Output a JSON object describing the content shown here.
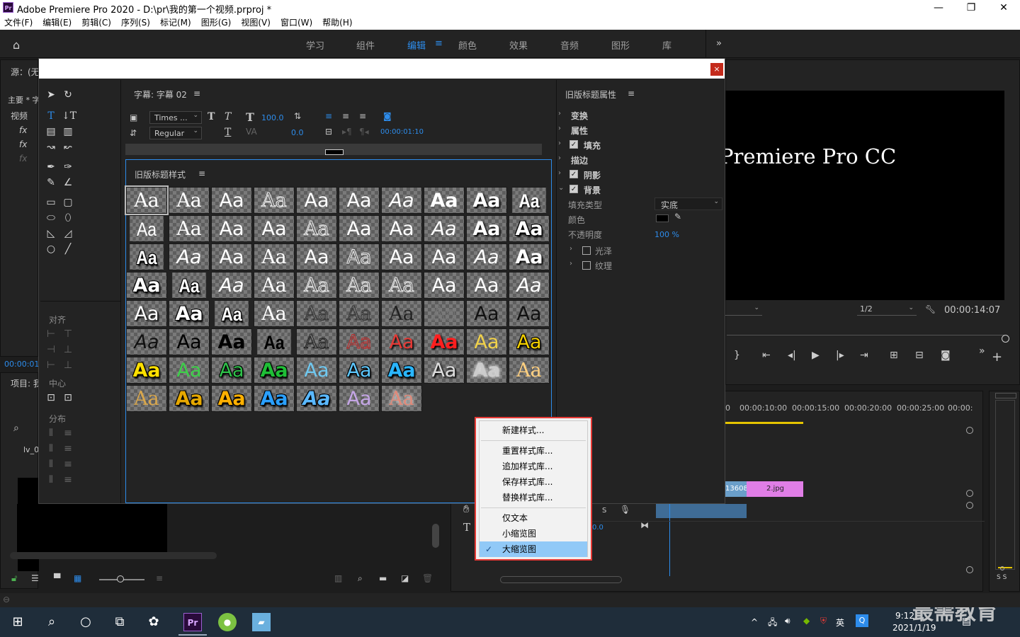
{
  "window": {
    "title": "Adobe Premiere Pro 2020 - D:\\pr\\我的第一个视频.prproj *",
    "logo": "Pr"
  },
  "menu": [
    "文件(F)",
    "编辑(E)",
    "剪辑(C)",
    "序列(S)",
    "标记(M)",
    "图形(G)",
    "视图(V)",
    "窗口(W)",
    "帮助(H)"
  ],
  "workspaces": [
    "学习",
    "组件",
    "编辑",
    "颜色",
    "效果",
    "音频",
    "图形",
    "库"
  ],
  "active_workspace": "编辑",
  "left": {
    "source_label": "源：(无",
    "main_label": "主要 * 字",
    "video_label": "视频",
    "time": "00:00:01:",
    "project_label": "项目: 我",
    "clip": "lv_0"
  },
  "titler": {
    "panel_title": "字幕: 字幕 02",
    "font_family": "Times ...",
    "font_style": "Regular",
    "font_size": "100.0",
    "kerning": "0.0",
    "timecode": "00:00:01:10",
    "styles_title": "旧版标题样式",
    "sections": {
      "align": "对齐",
      "center": "中心",
      "distribute": "分布"
    }
  },
  "properties": {
    "title": "旧版标题属性",
    "items": [
      "变换",
      "属性",
      "填充",
      "描边",
      "阴影",
      "背景"
    ],
    "fill_type_label": "填充类型",
    "fill_type_value": "实底",
    "color_label": "颜色",
    "opacity_label": "不透明度",
    "opacity_value": "100 %",
    "gloss": "光泽",
    "texture": "纹理"
  },
  "context_menu": {
    "items": [
      "新建样式...",
      "重置样式库...",
      "追加样式库...",
      "保存样式库...",
      "替换样式库...",
      "仅文本",
      "小缩览图",
      "大缩览图"
    ],
    "checked": "大缩览图"
  },
  "program": {
    "preview_text": "Premiere Pro CC",
    "zoom": "1/2",
    "timecode": "00:00:14:07"
  },
  "timeline": {
    "ruler": [
      "0",
      "00:00:10:00",
      "00:00:15:00",
      "00:00:20:00",
      "00:00:25:00",
      "00:00:"
    ],
    "clip_a": "13608.",
    "clip_b": "2.jpg",
    "audio_val": "0.0"
  },
  "taskbar": {
    "time": "9:12",
    "date": "2021/1/19",
    "ime": "英",
    "watermark": "最需教育"
  },
  "colors": {
    "accent": "#2d8ceb",
    "highlight": "#e53935",
    "pink_clip": "#e07ee6",
    "menu_select": "#91c9f7"
  }
}
